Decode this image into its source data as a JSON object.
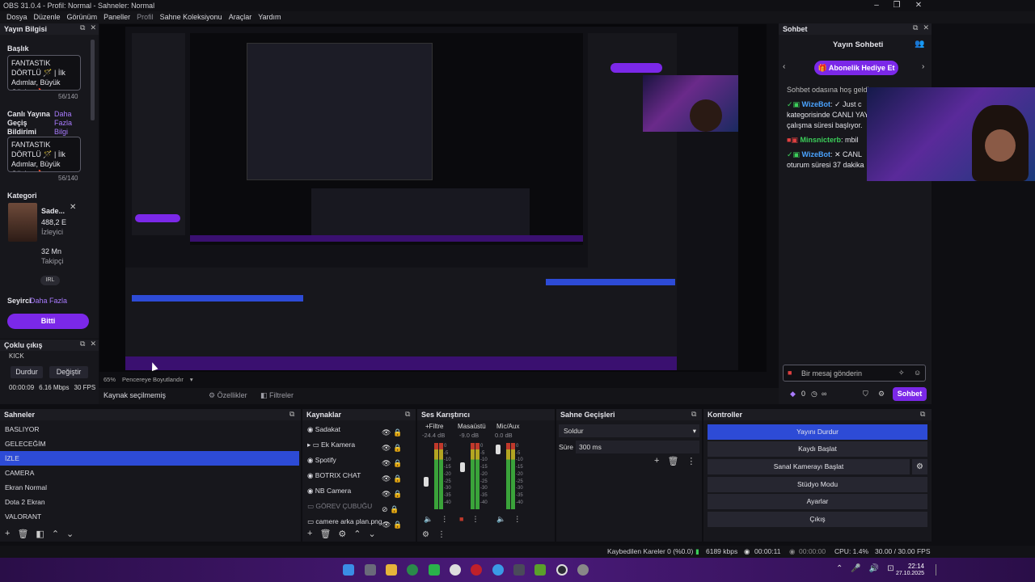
{
  "window": {
    "title": "OBS 31.0.4 - Profil: Normal - Sahneler: Normal"
  },
  "menu": [
    "Dosya",
    "Düzenle",
    "Görünüm",
    "Paneller",
    "Profil",
    "Sahne Koleksiyonu",
    "Araçlar",
    "Yardım"
  ],
  "stream_info": {
    "dock_title": "Yayın Bilgisi",
    "title_label": "Başlık",
    "title_value": "FANTASTIK DÖRTLÜ 🪄 | İlk Adımlar, Büyük Güçler 🔥",
    "title_count": "56/140",
    "notif_label_1": "Canlı Yayına",
    "notif_label_2": "Geçiş",
    "notif_label_3": "Bildirimi",
    "more": "Daha",
    "more2": "Fazla",
    "info": "Bilgi",
    "notif_value": "FANTASTIK DÖRTLÜ 🪄 | İlk Adımlar, Büyük Güçler 🔥",
    "notif_count": "56/140",
    "category_label": "Kategori",
    "category_name": "Sade...",
    "viewers_value": "488,2 E",
    "viewers_label": "İzleyici",
    "followers_value": "32 Mn",
    "followers_label": "Takipçi",
    "tag": "IRL",
    "audience_label": "Seyirci",
    "audience_more": "Daha Fazla",
    "done": "Bitti"
  },
  "multi_output": {
    "dock_title": "Çoklu çıkış",
    "platform": "KICK",
    "stop": "Durdur",
    "change": "Değiştir",
    "time": "00:00:09",
    "bitrate": "6.16 Mbps",
    "fps": "30 FPS"
  },
  "preview_bar": {
    "zoom": "65%",
    "resize": "Pencereye Boyutlandır"
  },
  "source_bar": {
    "none_selected": "Kaynak seçilmemiş",
    "properties": "Özellikler",
    "filters": "Filtreler"
  },
  "scenes": {
    "title": "Sahneler",
    "items": [
      "BASLIYOR",
      "GELECEĞİM",
      "İZLE",
      "CAMERA",
      "Ekran Normal",
      "Dota 2 Ekran",
      "VALORANT"
    ],
    "selected": 2
  },
  "sources": {
    "title": "Kaynaklar",
    "items": [
      "Sadakat",
      "Ek Kamera",
      "Spotify",
      "BOTRIX CHAT",
      "NB Camera",
      "GÖREV ÇUBUĞU",
      "camere arka plan.png"
    ]
  },
  "mixer": {
    "title": "Ses Karıştırıcı",
    "channels": [
      {
        "name": "+Filtre",
        "db": "-24.4 dB"
      },
      {
        "name": "Masaüstü",
        "db": "-9.0 dB"
      },
      {
        "name": "Mic/Aux",
        "db": "0.0 dB"
      }
    ],
    "scale": [
      "0",
      "-5",
      "-10",
      "-15",
      "-20",
      "-25",
      "-30",
      "-35",
      "-40"
    ]
  },
  "transitions": {
    "title": "Sahne Geçişleri",
    "type": "Soldur",
    "duration_label": "Süre",
    "duration": "300 ms"
  },
  "controls": {
    "title": "Kontroller",
    "buttons": [
      "Yayını Durdur",
      "Kaydı Başlat",
      "Sanal Kamerayı Başlat",
      "Stüdyo Modu",
      "Ayarlar",
      "Çıkış"
    ]
  },
  "chat": {
    "dock_title": "Sohbet",
    "header": "Yayın Sohbeti",
    "gift": "Abonelik Hediye Et",
    "welcome": "Sohbet odasına hoş geldi",
    "lines": [
      {
        "user": "WizeBot",
        "text": ": ✓ Just c"
      },
      {
        "user": "",
        "text": "kategorisinde CANLI YAY"
      },
      {
        "user": "",
        "text": "çalışma süresi başlıyor."
      },
      {
        "user": "Minsnicterb",
        "text": ": mbil"
      },
      {
        "user": "WizeBot",
        "text": ": ✕ CANL"
      },
      {
        "user": "",
        "text": "oturum süresi 37 dakika"
      }
    ],
    "placeholder": "Bir mesaj gönderin",
    "count": "0",
    "send": "Sohbet"
  },
  "status": {
    "dropped": "Kaybedilen Kareler 0 (%0.0)",
    "kbps": "6189 kbps",
    "stream_time": "00:00:11",
    "rec_time": "00:00:00",
    "cpu": "CPU: 1.4%",
    "fps": "30.00 / 30.00 FPS"
  },
  "clock": {
    "time": "22:14",
    "date": "27.10.2025"
  },
  "colors": {
    "accent": "#7b28e8",
    "selection": "#2d4bd6",
    "link": "#a97bff"
  }
}
